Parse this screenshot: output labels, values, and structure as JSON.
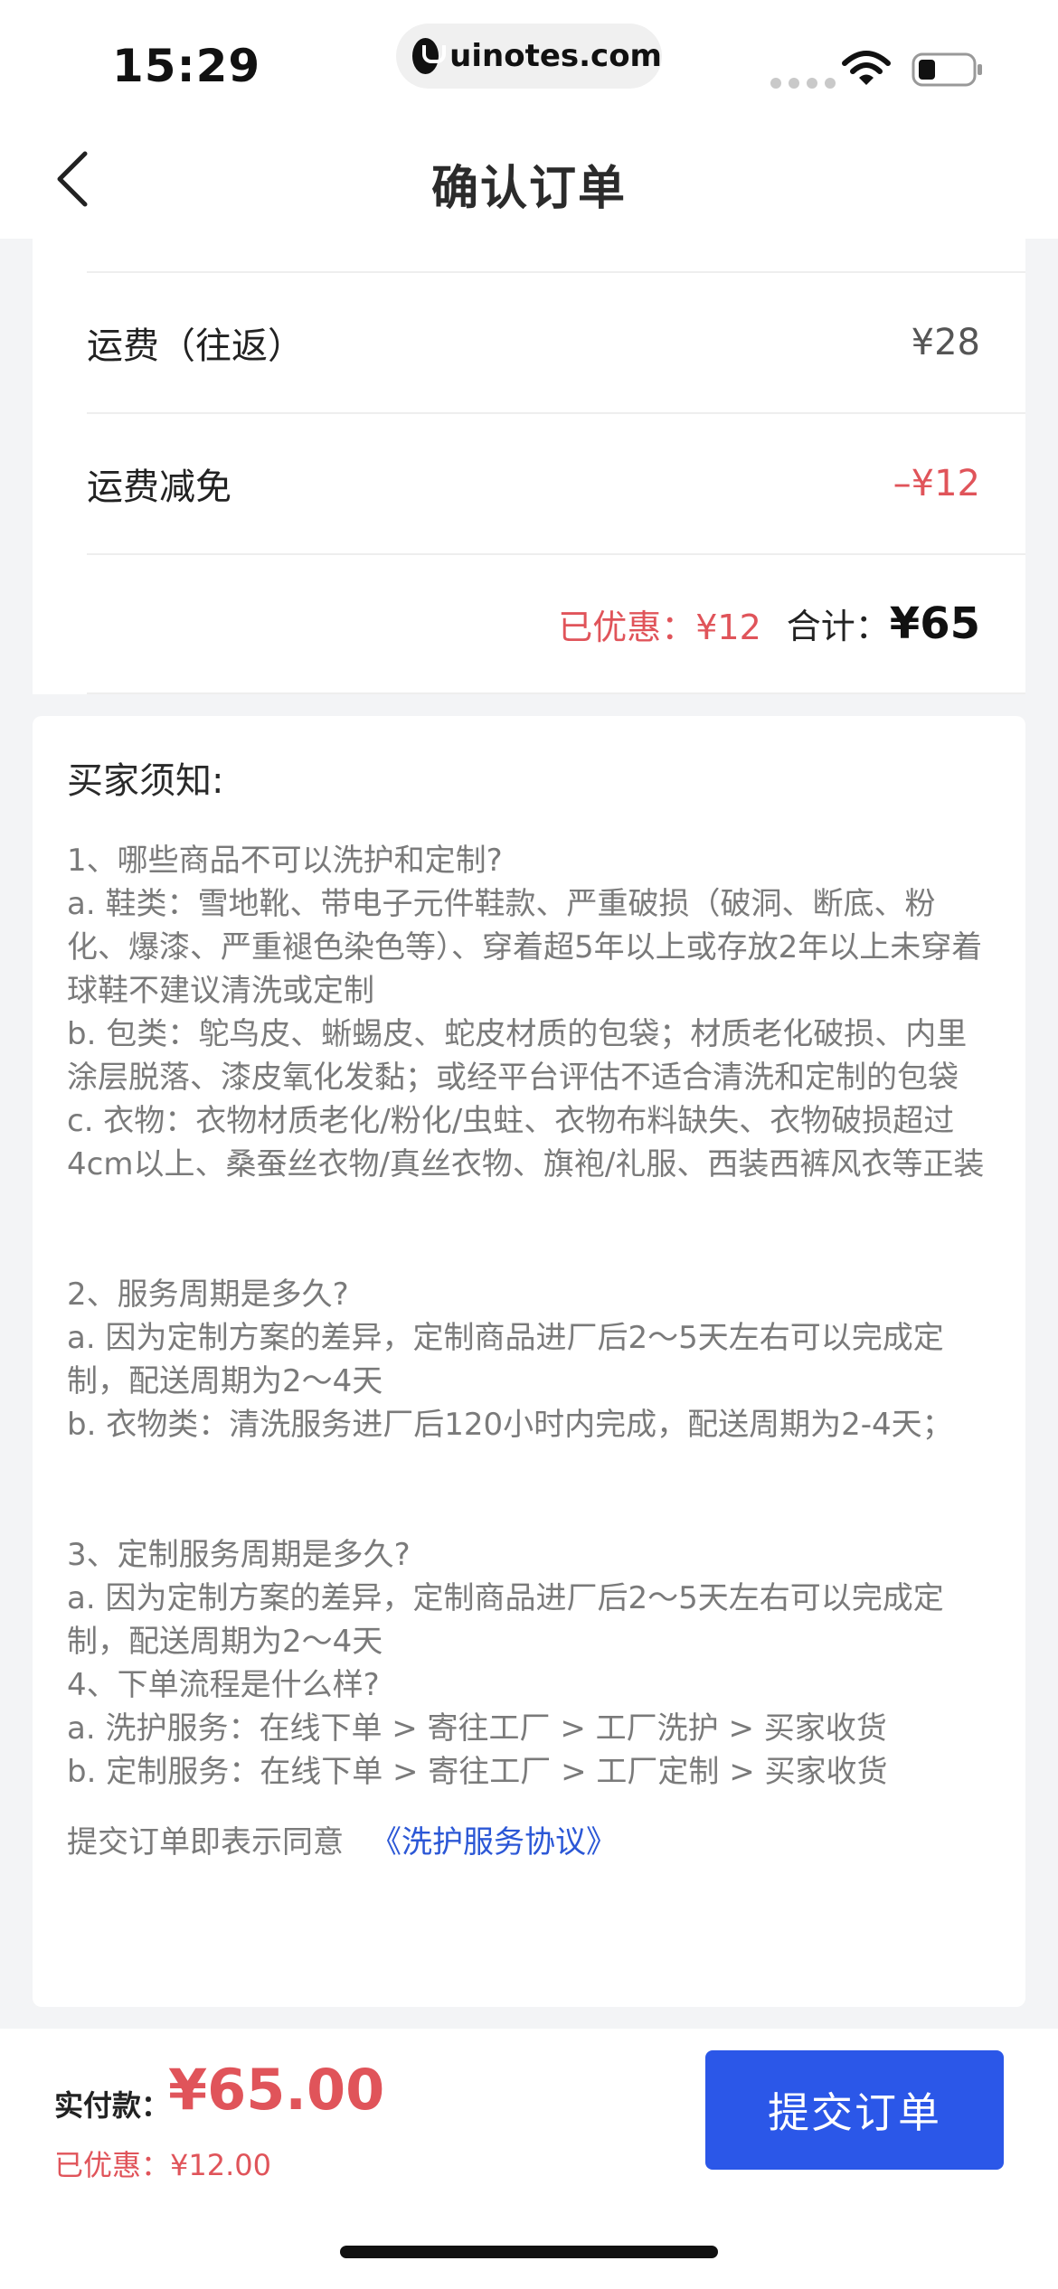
{
  "status_bar": {
    "time": "15:29",
    "url": "uinotes.com"
  },
  "nav": {
    "title": "确认订单"
  },
  "price_card": {
    "rows": [
      {
        "label": "运费（往返）",
        "value": "¥28"
      },
      {
        "label": "运费减免",
        "value": "–¥12"
      }
    ],
    "summary": {
      "saved": "已优惠：¥12",
      "total_label": "合计：",
      "total": "¥65"
    }
  },
  "notice": {
    "title": "买家须知:",
    "sections": [
      [
        "1、哪些商品不可以洗护和定制?",
        "a. 鞋类：雪地靴、带电子元件鞋款、严重破损（破洞、断底、粉化、爆漆、严重褪色染色等）、穿着超5年以上或存放2年以上未穿着球鞋不建议清洗或定制",
        "b. 包类：鸵鸟皮、蜥蜴皮、蛇皮材质的包袋；材质老化破损、内里涂层脱落、漆皮氧化发黏；或经平台评估不适合清洗和定制的包袋",
        "c. 衣物：衣物材质老化/粉化/虫蛀、衣物布料缺失、衣物破损超过4cm以上、桑蚕丝衣物/真丝衣物、旗袍/礼服、西装西裤风衣等正装"
      ],
      [
        "2、服务周期是多久?",
        "a. 因为定制方案的差异，定制商品进厂后2～5天左右可以完成定制，配送周期为2～4天",
        "b. 衣物类：清洗服务进厂后120小时内完成，配送周期为2-4天；"
      ],
      [
        "3、定制服务周期是多久?",
        "a. 因为定制方案的差异，定制商品进厂后2～5天左右可以完成定制，配送周期为2～4天",
        "4、下单流程是什么样?",
        "a. 洗护服务：在线下单 > 寄往工厂 > 工厂洗护 > 买家收货",
        "b. 定制服务：在线下单 > 寄往工厂 > 工厂定制 > 买家收货"
      ]
    ],
    "agreement_prefix": "提交订单即表示同意",
    "agreement_link": "《洗护服务协议》"
  },
  "bottom_bar": {
    "pay_label": "实付款：",
    "pay_amount": "¥65.00",
    "saved": "已优惠：¥12.00",
    "submit_label": "提交订单"
  },
  "colors": {
    "accent_red": "#e0545a",
    "primary_blue": "#2b57e8",
    "link_blue": "#2b57d6"
  }
}
